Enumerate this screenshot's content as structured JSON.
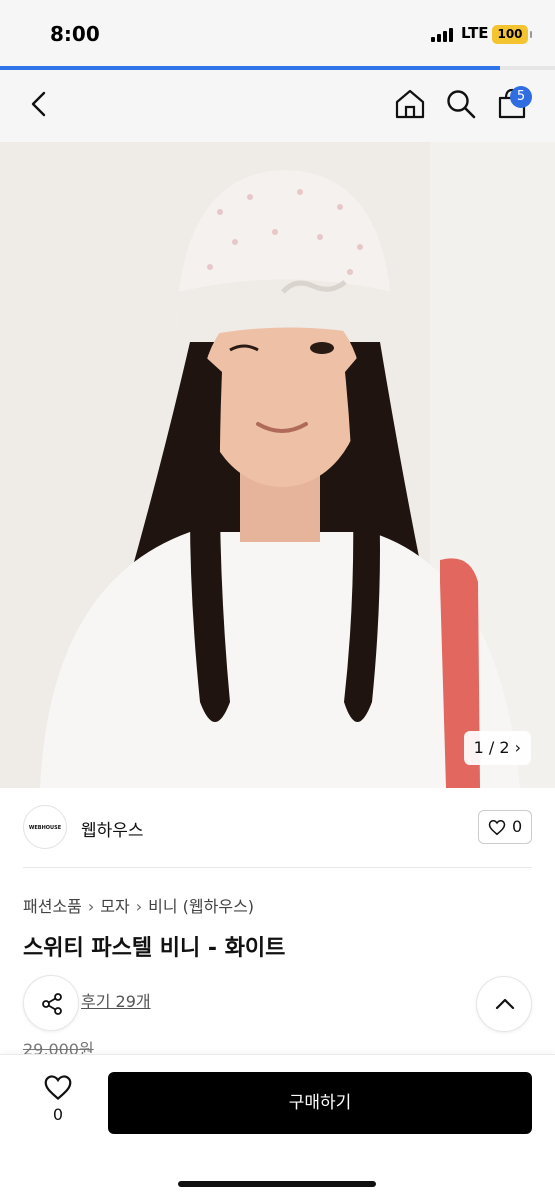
{
  "status_bar": {
    "time": "8:00",
    "network": "LTE",
    "battery": "100"
  },
  "page_load_progress": 0.9,
  "colors": {
    "accent": "#2f6de0",
    "buy_button": "#000000",
    "battery": "#f4c430"
  },
  "nav": {
    "cart_count": "5",
    "icons": [
      "back-arrow-icon",
      "home-icon",
      "search-icon",
      "cart-icon"
    ]
  },
  "gallery": {
    "counter": "1 / 2"
  },
  "seller": {
    "logo_text": "WEBHOUSE",
    "name": "웹하우스",
    "like_count": "0"
  },
  "breadcrumb": [
    "패션소품",
    "모자",
    "비니 (웹하우스)"
  ],
  "product": {
    "title": "스위티 파스텔 비니 - 화이트",
    "reviews": "후기 29개",
    "price": "29,000원"
  },
  "bottom_bar": {
    "wish_count": "0",
    "buy_label": "구매하기"
  }
}
